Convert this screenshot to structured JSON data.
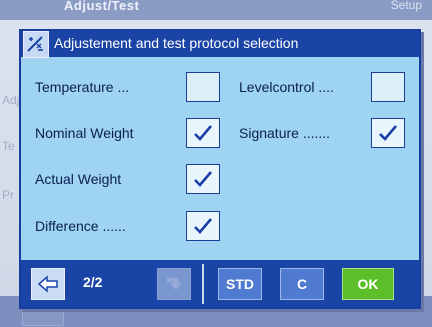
{
  "background": {
    "title": "Adjust/Test",
    "title_right": "Setup",
    "labels": [
      "Adj",
      "Te",
      "Pr"
    ]
  },
  "dialog": {
    "title": "Adjustement and test protocol selection",
    "left_rows": [
      {
        "label": "Temperature  ...",
        "checked": false
      },
      {
        "label": "Nominal Weight",
        "checked": true
      },
      {
        "label": "Actual Weight",
        "checked": true
      },
      {
        "label": "Difference  ......",
        "checked": true
      }
    ],
    "right_rows": [
      {
        "label": "Levelcontrol  ....",
        "checked": false
      },
      {
        "label": "Signature  .......",
        "checked": true
      }
    ]
  },
  "footer": {
    "page_indicator": "2/2",
    "std_label": "STD",
    "c_label": "C",
    "ok_label": "OK"
  },
  "colors": {
    "dialog_bg": "#9fd3f2",
    "header_bg": "#1a44a6",
    "check_color": "#1a3ea8",
    "ok_green": "#5cbf2a"
  }
}
